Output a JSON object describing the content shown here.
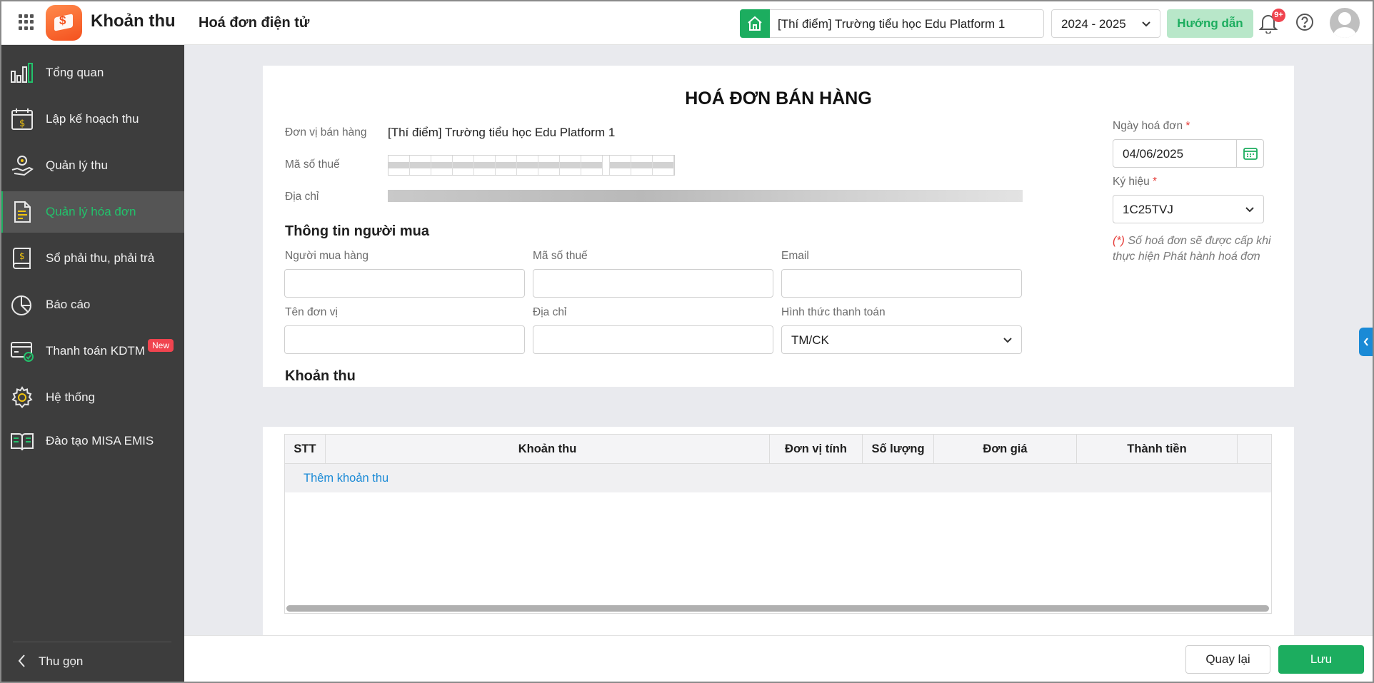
{
  "header": {
    "app_title": "Khoản thu",
    "page_title": "Hoá đơn điện tử",
    "school": "[Thí điểm] Trường tiểu học Edu Platform 1",
    "school_year": "2024 - 2025",
    "guide_label": "Hướng dẫn",
    "notification_count": "9+",
    "accent_color": "#1cad5f"
  },
  "sidebar": {
    "items": [
      {
        "label": "Tổng quan",
        "icon": "bar-chart-icon"
      },
      {
        "label": "Lập kế hoạch thu",
        "icon": "calendar-money-icon"
      },
      {
        "label": "Quản lý thu",
        "icon": "hand-coin-icon"
      },
      {
        "label": "Quản lý hóa đơn",
        "icon": "invoice-icon",
        "active": true
      },
      {
        "label": "Sổ phải thu, phải trả",
        "icon": "ledger-book-icon"
      },
      {
        "label": "Báo cáo",
        "icon": "pie-chart-icon"
      },
      {
        "label": "Thanh toán KDTM",
        "icon": "card-payment-icon",
        "badge": "New"
      },
      {
        "label": "Hệ thống",
        "icon": "gear-icon"
      },
      {
        "label": "Đào tạo MISA EMIS",
        "icon": "open-book-icon"
      }
    ],
    "collapse_label": "Thu gọn"
  },
  "invoice": {
    "title": "HOÁ ĐƠN BÁN HÀNG",
    "seller_label": "Đơn vị bán hàng",
    "seller_value": "[Thí điểm] Trường tiểu học Edu Platform 1",
    "tax_code_label": "Mã số thuế",
    "address_label": "Địa chỉ",
    "invoice_date_label": "Ngày hoá đơn",
    "invoice_date_value": "04/06/2025",
    "symbol_label": "Ký hiệu",
    "symbol_value": "1C25TVJ",
    "required_mark": "*",
    "note_mark": "(*)",
    "note_text": " Số hoá đơn sẽ được cấp khi thực hiện Phát hành hoá đơn"
  },
  "buyer": {
    "section_title": "Thông tin người mua",
    "buyer_name_label": "Người mua hàng",
    "buyer_name_value": "",
    "tax_code_label": "Mã số thuế",
    "tax_code_value": "",
    "email_label": "Email",
    "email_value": "",
    "unit_name_label": "Tên đơn vị",
    "unit_name_value": "",
    "address_label": "Địa chỉ",
    "address_value": "",
    "payment_method_label": "Hình thức thanh toán",
    "payment_method_value": "TM/CK"
  },
  "fees": {
    "section_title": "Khoản thu",
    "columns": [
      "STT",
      "Khoản thu",
      "Đơn vị tính",
      "Số lượng",
      "Đơn giá",
      "Thành tiền"
    ],
    "add_label": "Thêm khoản thu"
  },
  "footer": {
    "back_label": "Quay lại",
    "save_label": "Lưu"
  }
}
